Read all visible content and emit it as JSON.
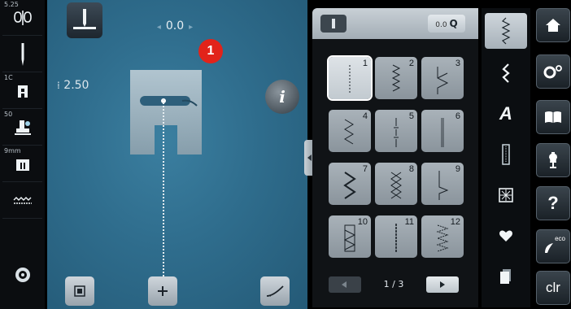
{
  "left_toolbar": {
    "items": [
      {
        "name": "upper-thread-tension",
        "small_label": "5.25"
      },
      {
        "name": "needle-selection",
        "small_label": ""
      },
      {
        "name": "needle-plate",
        "small_label": "1C"
      },
      {
        "name": "presser-foot-pressure",
        "small_label": "50"
      },
      {
        "name": "presser-foot-indicator",
        "small_label": "9mm"
      },
      {
        "name": "feed-dog",
        "small_label": ""
      },
      {
        "name": "bobbin-indicator",
        "small_label": ""
      }
    ]
  },
  "main": {
    "needle_position": "0.0",
    "badge": "1",
    "stitch_width": "2.50",
    "info_label": "i",
    "colors": {
      "background": "#2f6d8d",
      "badge": "#e2231a"
    }
  },
  "stitch_panel": {
    "zoom_label": "Q",
    "zoom_prefix": "0.0",
    "page": "1 / 3",
    "selected": 1,
    "stitches": [
      {
        "num": "1",
        "pattern": "straight"
      },
      {
        "num": "2",
        "pattern": "zigzag-narrow"
      },
      {
        "num": "3",
        "pattern": "vari-overlock"
      },
      {
        "num": "4",
        "pattern": "running-stitch"
      },
      {
        "num": "5",
        "pattern": "securing"
      },
      {
        "num": "6",
        "pattern": "triple-straight"
      },
      {
        "num": "7",
        "pattern": "triple-zigzag"
      },
      {
        "num": "8",
        "pattern": "honeycomb"
      },
      {
        "num": "9",
        "pattern": "blindstitch"
      },
      {
        "num": "10",
        "pattern": "double-overlock"
      },
      {
        "num": "11",
        "pattern": "super-stretch"
      },
      {
        "num": "12",
        "pattern": "gathering"
      }
    ]
  },
  "categories": [
    {
      "name": "practical-stitches",
      "icon": "straight-stitch-icon",
      "active": true
    },
    {
      "name": "decorative-stitches",
      "icon": "decorative-stitch-icon",
      "active": false
    },
    {
      "name": "alphabets",
      "icon": "alphabet-icon",
      "label": "A",
      "active": false
    },
    {
      "name": "buttonholes",
      "icon": "buttonhole-icon",
      "active": false
    },
    {
      "name": "quilt-stitches",
      "icon": "quilt-icon",
      "active": false
    },
    {
      "name": "personal-program",
      "icon": "heart-icon",
      "active": false
    },
    {
      "name": "memory",
      "icon": "memory-icon",
      "active": false
    }
  ],
  "right_toolbar": {
    "home": "home-icon",
    "setup": "setup-icon",
    "tutorial": "book-icon",
    "guide": "dress-form-icon",
    "help_label": "?",
    "eco_label": "eco",
    "clear_label": "clr"
  }
}
